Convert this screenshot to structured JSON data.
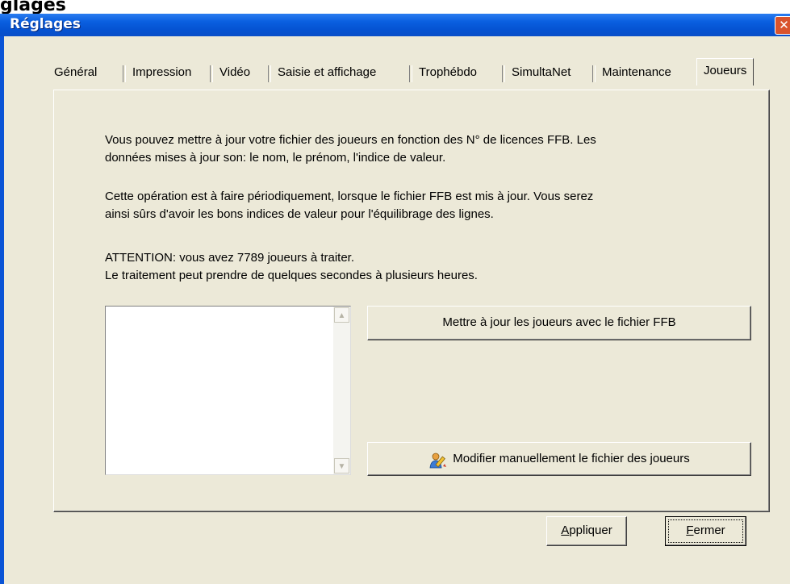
{
  "background": {
    "partial_title": "glages"
  },
  "window": {
    "title": "Réglages",
    "close_icon": "close-icon"
  },
  "tabs": [
    {
      "label": "Général",
      "active": false
    },
    {
      "label": "Impression",
      "active": false
    },
    {
      "label": "Vidéo",
      "active": false
    },
    {
      "label": "Saisie et affichage",
      "active": false
    },
    {
      "label": "Trophébdo",
      "active": false
    },
    {
      "label": "SimultaNet",
      "active": false
    },
    {
      "label": "Maintenance",
      "active": false
    },
    {
      "label": "Joueurs",
      "active": true
    }
  ],
  "panel": {
    "para1_line1": "Vous pouvez mettre à jour votre fichier des joueurs en fonction des N° de licences FFB. Les",
    "para1_line2": "données mises à jour son: le nom, le prénom, l'indice de valeur.",
    "para2_line1": "Cette opération est à faire périodiquement, lorsque le fichier FFB est mis à jour. Vous serez",
    "para2_line2": "ainsi sûrs d'avoir les bons indices de valeur pour l'équilibrage des lignes.",
    "para3_line1": "ATTENTION: vous avez 7789 joueurs à traiter.",
    "para3_line2": "Le traitement peut prendre de quelques secondes à plusieurs heures.",
    "update_button": "Mettre à jour les joueurs avec le fichier FFB",
    "manual_button": "Modifier manuellement le fichier des joueurs",
    "manual_icon": "edit-player-icon"
  },
  "footer": {
    "apply_first": "A",
    "apply_rest": "ppliquer",
    "close_first": "F",
    "close_rest": "ermer"
  }
}
